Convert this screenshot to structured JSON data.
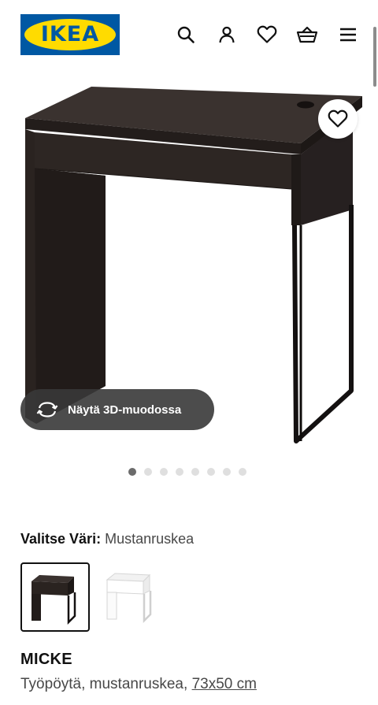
{
  "header": {
    "logo_text": "IKEA",
    "icons": [
      "search-icon",
      "user-icon",
      "heart-icon",
      "basket-icon",
      "menu-icon"
    ]
  },
  "hero": {
    "view_3d_label": "Näytä 3D-muodossa",
    "slide_count": 8,
    "active_slide": 1
  },
  "colour": {
    "label": "Valitse Väri:",
    "value": "Mustanruskea",
    "swatches": [
      "black-brown",
      "white"
    ]
  },
  "product": {
    "name": "MICKE",
    "description": "Työpöytä, mustanruskea,",
    "size": "73x50 cm"
  },
  "colors": {
    "brand_blue": "#0058a3",
    "brand_yellow": "#ffdb00",
    "desk_dark": "#2b2422"
  }
}
